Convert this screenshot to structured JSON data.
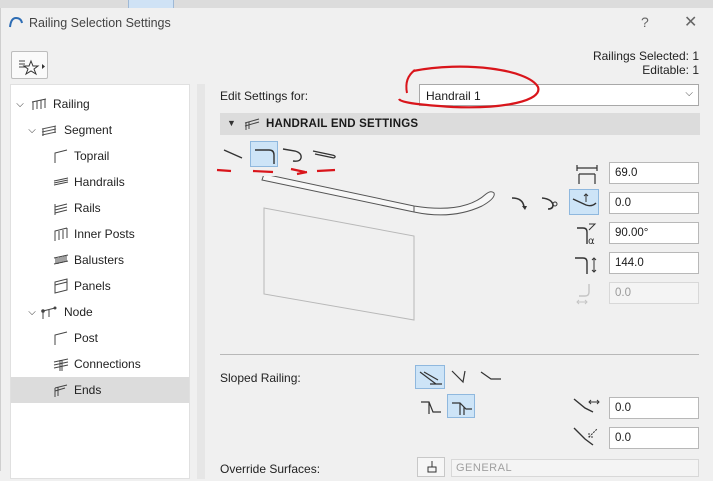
{
  "window": {
    "title": "Railing Selection Settings",
    "help": "?",
    "close": "✕"
  },
  "selection_info": {
    "selected": "Railings Selected: 1",
    "editable": "Editable: 1"
  },
  "tree": [
    {
      "label": "Railing",
      "icon": "railing-icon"
    },
    {
      "label": "Segment",
      "icon": "segment-icon"
    },
    {
      "label": "Toprail",
      "icon": "toprail-icon"
    },
    {
      "label": "Handrails",
      "icon": "handrails-icon"
    },
    {
      "label": "Rails",
      "icon": "rails-icon"
    },
    {
      "label": "Inner Posts",
      "icon": "inner-posts-icon"
    },
    {
      "label": "Balusters",
      "icon": "balusters-icon"
    },
    {
      "label": "Panels",
      "icon": "panels-icon"
    },
    {
      "label": "Node",
      "icon": "node-icon"
    },
    {
      "label": "Post",
      "icon": "post-icon"
    },
    {
      "label": "Connections",
      "icon": "connections-icon"
    },
    {
      "label": "Ends",
      "icon": "ends-icon",
      "selected": true
    }
  ],
  "edit_settings": {
    "label": "Edit Settings for:",
    "value": "Handrail 1"
  },
  "section": {
    "title": "HANDRAIL END SETTINGS"
  },
  "fields": {
    "length": "69.0",
    "offset": "0.0",
    "angle": "90.00°",
    "height": "144.0",
    "disabled_value": "0.0"
  },
  "sloped": {
    "label": "Sloped Railing:",
    "value_a": "0.0",
    "value_b": "0.0"
  },
  "override": {
    "label": "Override Surfaces:",
    "value": "GENERAL"
  },
  "colors": {
    "accent_bg": "#cde4f7",
    "accent_border": "#8fb8de",
    "annotation": "#d9151b"
  }
}
